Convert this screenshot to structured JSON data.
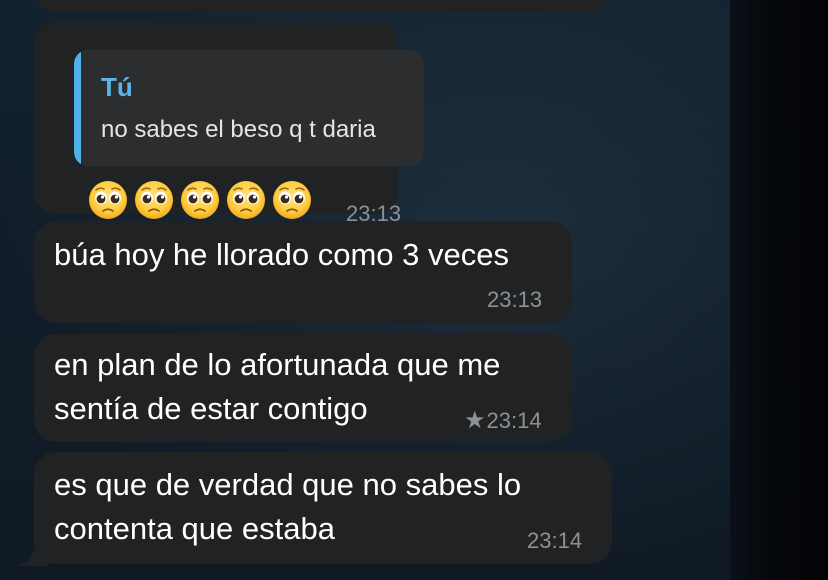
{
  "chat": {
    "reply_message": {
      "quote_author": "Tú",
      "quote_text": "no sabes el beso q t daria",
      "emojis": [
        "pleading-face",
        "pleading-face",
        "pleading-face",
        "pleading-face",
        "pleading-face"
      ],
      "time": "23:13"
    },
    "messages": [
      {
        "lines": [
          "búa hoy he llorado como 3 veces"
        ],
        "time": "23:13",
        "starred": false
      },
      {
        "lines": [
          "en plan de lo afortunada que me",
          "sentía de estar contigo"
        ],
        "time": "23:14",
        "starred": true
      },
      {
        "lines": [
          "es que de verdad que no sabes lo",
          "contenta que estaba"
        ],
        "time": "23:14",
        "starred": false
      }
    ]
  },
  "colors": {
    "bubble": "#212223",
    "quote_bar": "#4fb2e8",
    "quote_author": "#58b6ec",
    "timestamp": "#8e9193",
    "background": "#0e1821"
  },
  "icons": {
    "star": "★",
    "emoji": "pleading-face"
  }
}
